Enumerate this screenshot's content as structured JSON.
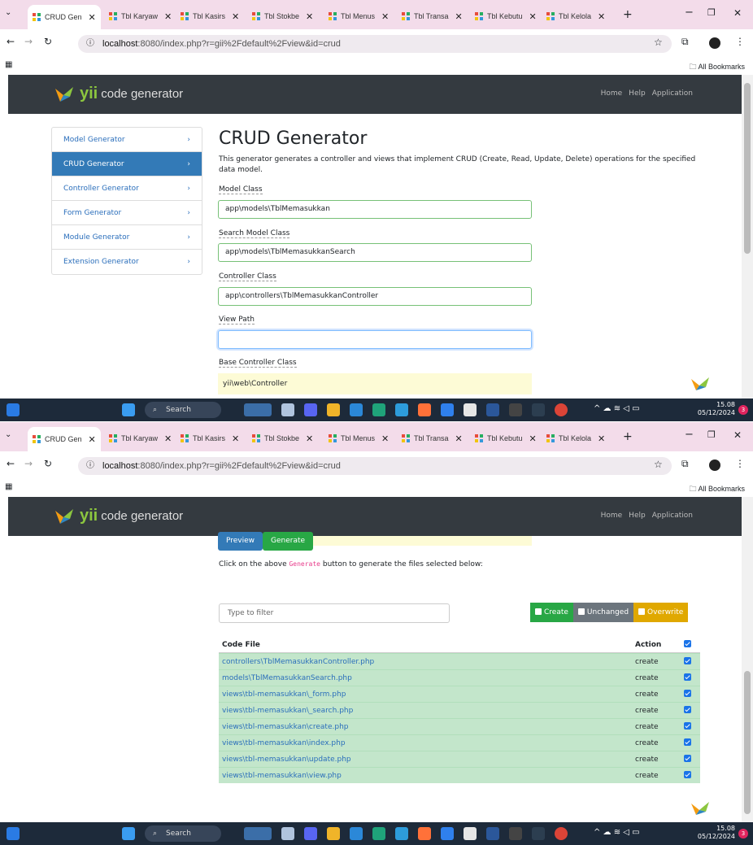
{
  "browser": {
    "tabs": [
      {
        "label": "CRUD Gen",
        "active": true
      },
      {
        "label": "Tbl Karyaw"
      },
      {
        "label": "Tbl Kasirs"
      },
      {
        "label": "Tbl Stokbe"
      },
      {
        "label": "Tbl Menus"
      },
      {
        "label": "Tbl Transa"
      },
      {
        "label": "Tbl Kebutu"
      },
      {
        "label": "Tbl Kelola"
      }
    ],
    "new_tab": "+",
    "url_host": "localhost",
    "url_rest": ":8080/index.php?r=gii%2Fdefault%2Fview&id=crud",
    "bookmarks": "All Bookmarks"
  },
  "navbar": {
    "brand_yii": "yii",
    "brand_text": "code generator",
    "links": [
      "Home",
      "Help",
      "Application"
    ]
  },
  "sidebar": [
    "Model Generator",
    "CRUD Generator",
    "Controller Generator",
    "Form Generator",
    "Module Generator",
    "Extension Generator"
  ],
  "main": {
    "title": "CRUD Generator",
    "description": "This generator generates a controller and views that implement CRUD (Create, Read, Update, Delete) operations for the specified data model.",
    "fields": [
      {
        "label": "Model Class",
        "value": "app\\models\\TblMemasukkan"
      },
      {
        "label": "Search Model Class",
        "value": "app\\models\\TblMemasukkanSearch"
      },
      {
        "label": "Controller Class",
        "value": "app\\controllers\\TblMemasukkanController"
      },
      {
        "label": "View Path",
        "value": ""
      },
      {
        "label": "Base Controller Class",
        "value": "yii\\web\\Controller"
      }
    ]
  },
  "generate": {
    "preview": "Preview",
    "generate": "Generate",
    "hint_before": "Click on the above ",
    "hint_code": "Generate",
    "hint_after": " button to generate the files selected below:",
    "filter_placeholder": "Type to filter",
    "toggles": [
      "Create",
      "Unchanged",
      "Overwrite"
    ],
    "col_file": "Code File",
    "col_action": "Action",
    "files": [
      {
        "file": "controllers\\TblMemasukkanController.php",
        "action": "create"
      },
      {
        "file": "models\\TblMemasukkanSearch.php",
        "action": "create"
      },
      {
        "file": "views\\tbl-memasukkan\\_form.php",
        "action": "create"
      },
      {
        "file": "views\\tbl-memasukkan\\_search.php",
        "action": "create"
      },
      {
        "file": "views\\tbl-memasukkan\\create.php",
        "action": "create"
      },
      {
        "file": "views\\tbl-memasukkan\\index.php",
        "action": "create"
      },
      {
        "file": "views\\tbl-memasukkan\\update.php",
        "action": "create"
      },
      {
        "file": "views\\tbl-memasukkan\\view.php",
        "action": "create"
      }
    ]
  },
  "taskbar": {
    "search": "Search",
    "time": "15.08",
    "date": "05/12/2024",
    "notifications": "3"
  },
  "colors": {
    "navbar": "#343a40",
    "primary": "#337ab7",
    "success": "#28a745",
    "warning": "#e0a800",
    "row": "#c3e6cb",
    "yii": "#8cc63f"
  }
}
